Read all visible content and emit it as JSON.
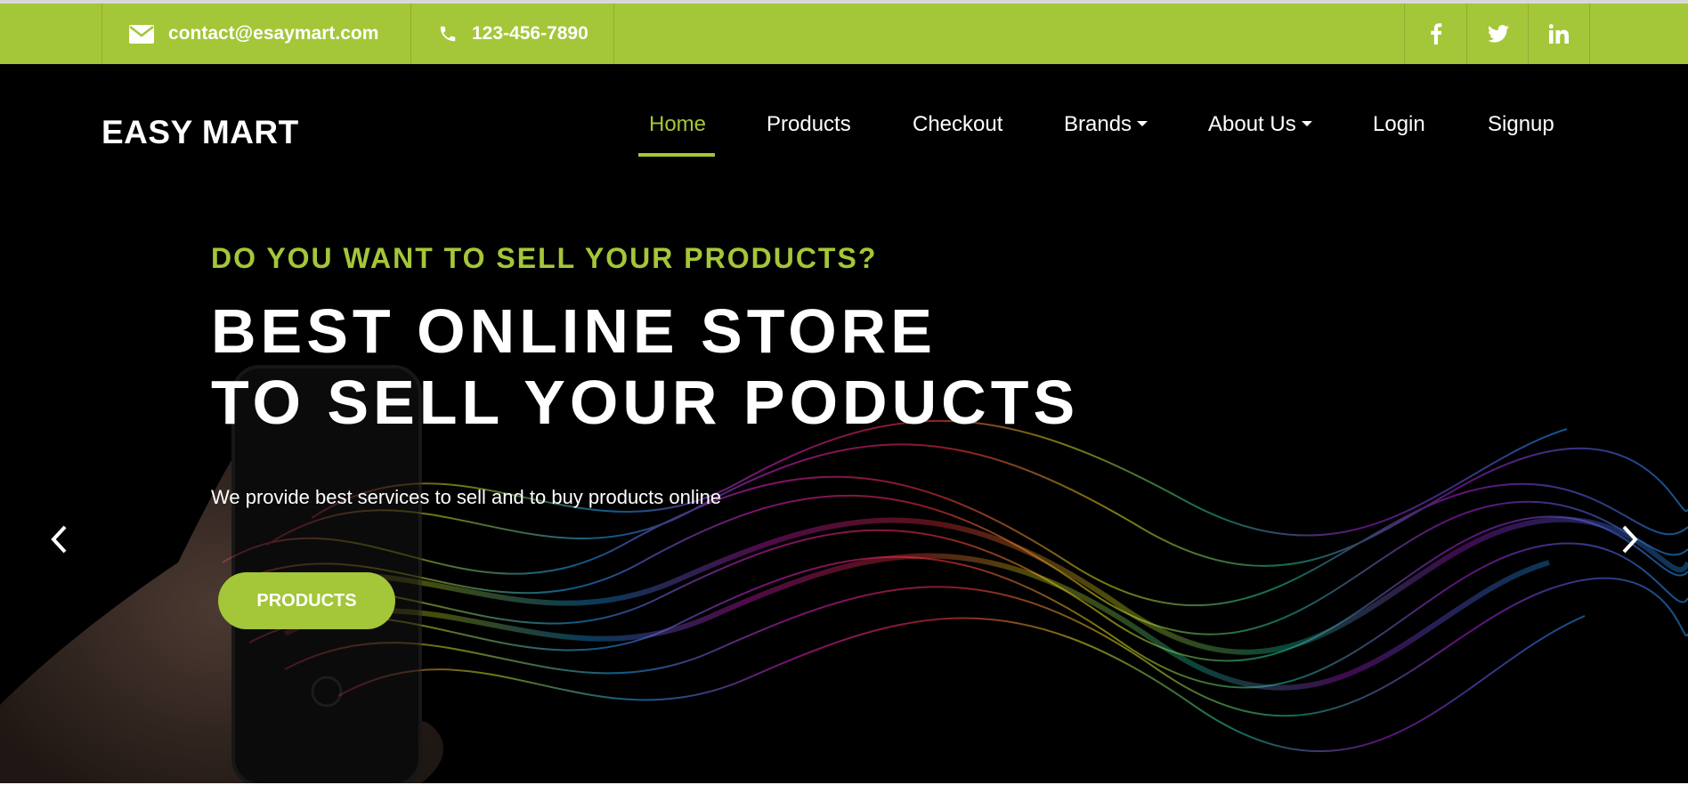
{
  "topbar": {
    "email": "contact@esaymart.com",
    "phone": "123-456-7890",
    "email_icon": "envelope-icon",
    "phone_icon": "phone-icon",
    "social": [
      {
        "name": "facebook-icon",
        "glyph": "f"
      },
      {
        "name": "twitter-icon",
        "glyph": "twitter"
      },
      {
        "name": "linkedin-icon",
        "glyph": "in"
      }
    ]
  },
  "header": {
    "logo": "EASY MART",
    "nav": [
      {
        "label": "Home",
        "active": true
      },
      {
        "label": "Products"
      },
      {
        "label": "Checkout"
      },
      {
        "label": "Brands",
        "dropdown": true
      },
      {
        "label": "About Us",
        "dropdown": true
      },
      {
        "label": "Login"
      },
      {
        "label": "Signup"
      }
    ]
  },
  "hero": {
    "pretitle": "DO YOU WANT TO SELL YOUR PRODUCTS?",
    "title_line1": "BEST ONLINE STORE",
    "title_line2": "TO SELL YOUR PODUCTS",
    "description": "We provide best services to sell and to buy products online",
    "button": "PRODUCTS",
    "prev_icon": "chevron-left-icon",
    "next_icon": "chevron-right-icon"
  },
  "colors": {
    "accent": "#a4c639",
    "hero_bg": "#000000",
    "text": "#ffffff"
  }
}
